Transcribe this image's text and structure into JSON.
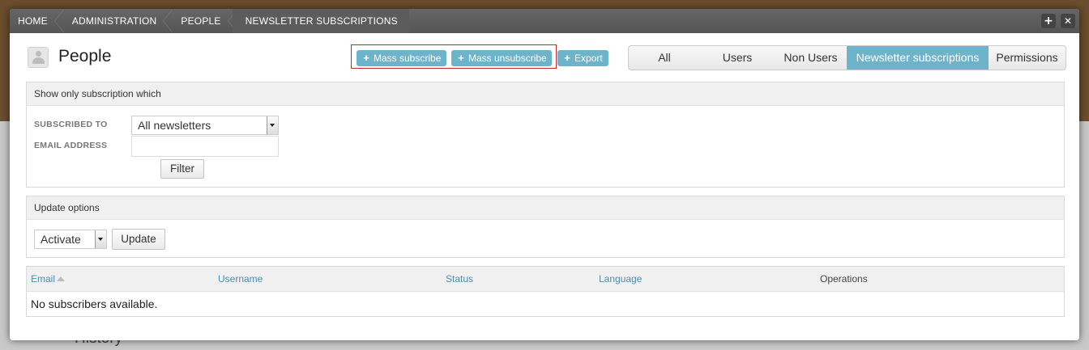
{
  "background": {
    "history_text": "History"
  },
  "toolbar": {
    "breadcrumbs": [
      "HOME",
      "ADMINISTRATION",
      "PEOPLE",
      "NEWSLETTER SUBSCRIPTIONS"
    ],
    "expand_symbol": "+",
    "close_symbol": "✕"
  },
  "page": {
    "title": "People",
    "icon": "user-icon"
  },
  "actions": {
    "plus_symbol": "+",
    "mass_subscribe": "Mass subscribe",
    "mass_unsubscribe": "Mass unsubscribe",
    "export": "Export"
  },
  "tabs": {
    "all": "All",
    "users": "Users",
    "non_users": "Non Users",
    "newsletter_subscriptions": "Newsletter subscriptions",
    "permissions": "Permissions",
    "active": "Newsletter subscriptions"
  },
  "filter": {
    "heading": "Show only subscription which",
    "subscribed_to_label": "SUBSCRIBED TO",
    "subscribed_to_value": "All newsletters",
    "email_label": "EMAIL ADDRESS",
    "email_value": "",
    "filter_button": "Filter"
  },
  "update": {
    "heading": "Update options",
    "option_value": "Activate",
    "update_button": "Update"
  },
  "table": {
    "columns": [
      "Email",
      "Username",
      "Status",
      "Language",
      "Operations"
    ],
    "sorted_column": "Email",
    "empty_text": "No subscribers available."
  },
  "colors": {
    "accent": "#6db3c9",
    "link": "#4a8db0",
    "highlight_border": "#c0282d",
    "toolbar": "#555555"
  }
}
